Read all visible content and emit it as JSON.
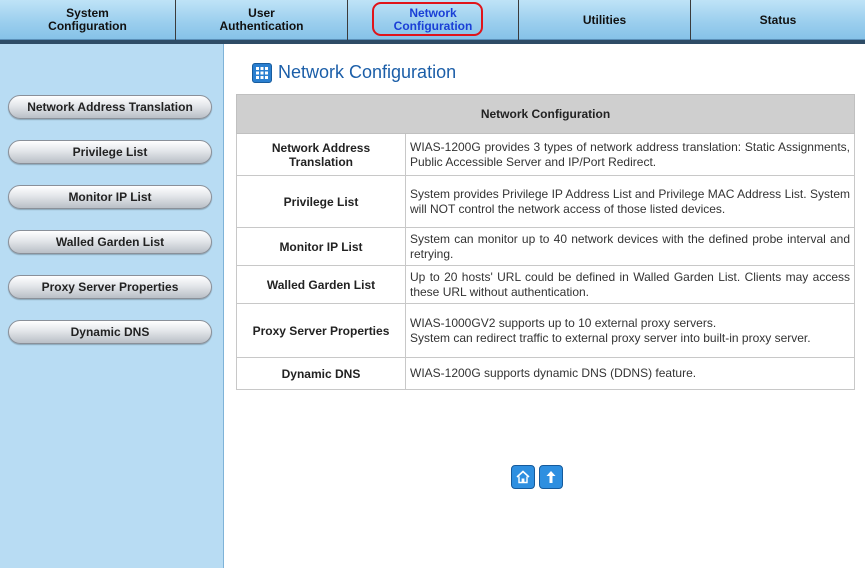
{
  "topnav": {
    "tabs": [
      {
        "line1": "System",
        "line2": "Configuration"
      },
      {
        "line1": "User",
        "line2": "Authentication"
      },
      {
        "line1": "Network",
        "line2": "Configuration"
      },
      {
        "line1": "Utilities",
        "line2": ""
      },
      {
        "line1": "Status",
        "line2": ""
      }
    ],
    "active_tab": "Network Configuration"
  },
  "sidebar": {
    "items": [
      {
        "label": "Network Address Translation"
      },
      {
        "label": "Privilege List"
      },
      {
        "label": "Monitor IP List"
      },
      {
        "label": "Walled Garden List"
      },
      {
        "label": "Proxy Server Properties"
      },
      {
        "label": "Dynamic DNS"
      }
    ]
  },
  "main": {
    "title": "Network Configuration",
    "table": {
      "header": "Network Configuration",
      "rows": [
        {
          "name": "Network Address Translation",
          "desc": "WIAS-1200G provides 3 types of network address translation: Static Assignments, Public Accessible Server and IP/Port Redirect."
        },
        {
          "name": "Privilege List",
          "desc": "System provides Privilege IP Address List and Privilege MAC Address List. System will NOT control the network access of those listed devices."
        },
        {
          "name": "Monitor IP List",
          "desc": "System can monitor up to 40 network devices with the defined probe interval and retrying."
        },
        {
          "name": "Walled Garden List",
          "desc": "Up to 20 hosts' URL could be defined in Walled Garden List. Clients may access these URL without authentication."
        },
        {
          "name": "Proxy Server Properties",
          "desc_line1": "WIAS-1000GV2 supports up to 10 external proxy servers.",
          "desc_line2": "System can redirect traffic to external proxy server into built-in proxy server."
        },
        {
          "name": "Dynamic DNS",
          "desc": "WIAS-1200G supports dynamic DNS (DDNS) feature."
        }
      ]
    },
    "icons": {
      "home": "home-icon",
      "top": "arrow-up-icon"
    }
  },
  "colors": {
    "accent": "#1b5ea8",
    "sidebar_bg": "#b8dcf3",
    "highlight": "#e0141a"
  }
}
